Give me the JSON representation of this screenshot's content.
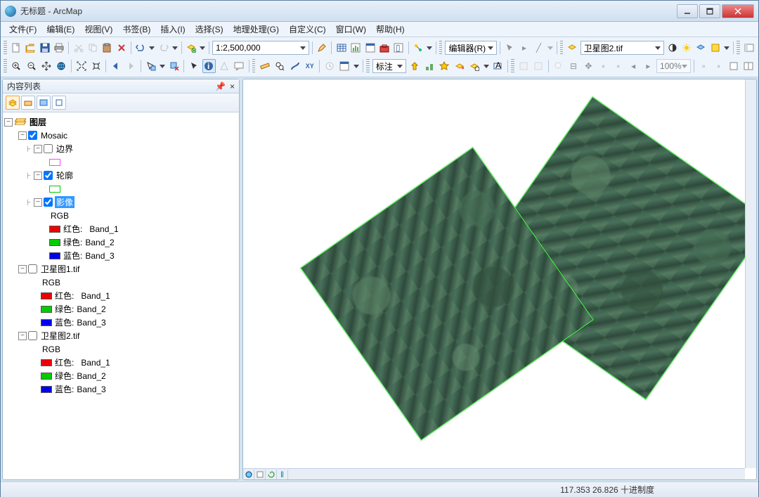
{
  "window": {
    "title": "无标题 - ArcMap"
  },
  "menu": {
    "file": "文件(F)",
    "edit": "编辑(E)",
    "view": "视图(V)",
    "bookmarks": "书签(B)",
    "insert": "插入(I)",
    "select": "选择(S)",
    "geoprocessing": "地理处理(G)",
    "customize": "自定义(C)",
    "window": "窗口(W)",
    "help": "帮助(H)"
  },
  "toolbar": {
    "scale": "1:2,500,000",
    "editor_label": "编辑器(R)",
    "layer_combo": "卫星图2.tif",
    "annotation_label": "标注",
    "percent": "100%"
  },
  "toc": {
    "title": "内容列表",
    "root": "图层",
    "mosaic": {
      "label": "Mosaic",
      "boundary": "边界",
      "footprint": "轮廓",
      "image": "影像",
      "rgb": "RGB",
      "red": "红色:",
      "green": "绿色:",
      "blue": "蓝色:",
      "band1": "Band_1",
      "band2": "Band_2",
      "band3": "Band_3"
    },
    "layers": [
      {
        "name": "卫星图1.tif"
      },
      {
        "name": "卫星图2.tif"
      }
    ]
  },
  "status": {
    "coords": "117.353  26.826 十进制度"
  }
}
